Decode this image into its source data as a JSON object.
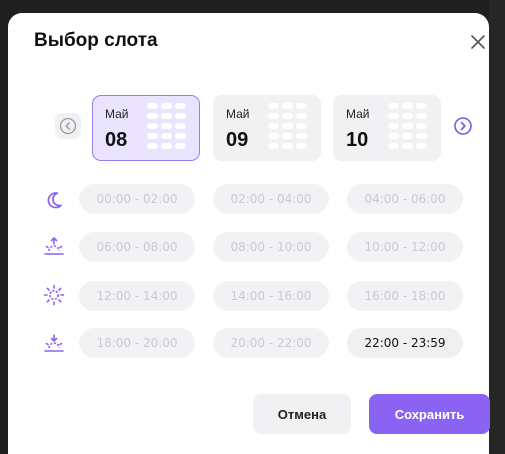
{
  "dialog": {
    "title": "Выбор слота",
    "close_icon": "close-icon"
  },
  "dates": [
    {
      "month": "Май",
      "day": "08",
      "selected": true
    },
    {
      "month": "Май",
      "day": "09",
      "selected": false
    },
    {
      "month": "Май",
      "day": "10",
      "selected": false
    }
  ],
  "rows": [
    {
      "icon": "moon-icon",
      "slots": [
        {
          "label": "00:00 - 02:00",
          "available": false
        },
        {
          "label": "02:00 - 04:00",
          "available": false
        },
        {
          "label": "04:00 - 06:00",
          "available": false
        }
      ]
    },
    {
      "icon": "sunrise-icon",
      "slots": [
        {
          "label": "06:00 - 08:00",
          "available": false
        },
        {
          "label": "08:00 - 10:00",
          "available": false
        },
        {
          "label": "10:00 - 12:00",
          "available": false
        }
      ]
    },
    {
      "icon": "sun-icon",
      "slots": [
        {
          "label": "12:00 - 14:00",
          "available": false
        },
        {
          "label": "14:00 - 16:00",
          "available": false
        },
        {
          "label": "16:00 - 18:00",
          "available": false
        }
      ]
    },
    {
      "icon": "sunset-icon",
      "slots": [
        {
          "label": "18:00 - 20:00",
          "available": false
        },
        {
          "label": "20:00 - 22:00",
          "available": false
        },
        {
          "label": "22:00 - 23:59",
          "available": true
        }
      ]
    }
  ],
  "actions": {
    "cancel_label": "Отмена",
    "save_label": "Сохранить"
  },
  "colors": {
    "accent": "#8a63f2",
    "selected_bg": "#ebe4ff",
    "disabled_text": "#c9c9ce"
  }
}
